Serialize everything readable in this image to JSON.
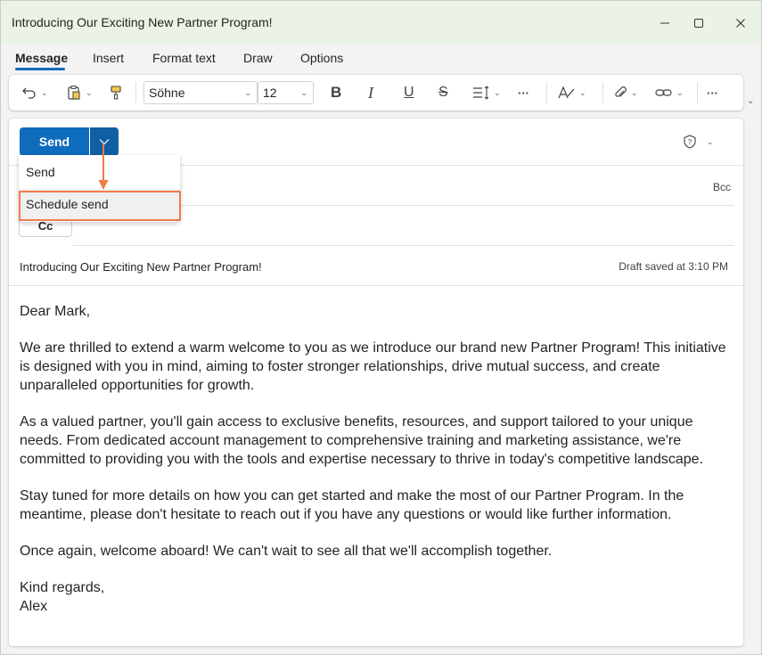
{
  "window": {
    "title": "Introducing Our Exciting New Partner Program!"
  },
  "tabs": [
    {
      "label": "Message",
      "active": true
    },
    {
      "label": "Insert"
    },
    {
      "label": "Format text"
    },
    {
      "label": "Draw"
    },
    {
      "label": "Options"
    }
  ],
  "ribbon": {
    "font_name": "Söhne",
    "font_size": "12",
    "bold_glyph": "B",
    "italic_glyph": "I",
    "underline_glyph": "U",
    "strike_glyph": "S",
    "more_glyph": "···"
  },
  "compose": {
    "send_label": "Send",
    "bcc_label": "Bcc",
    "cc_label": "Cc",
    "subject": "Introducing Our Exciting New Partner Program!",
    "draft_status": "Draft saved at 3:10 PM"
  },
  "send_menu": {
    "items": [
      {
        "label": "Send"
      },
      {
        "label": "Schedule send",
        "highlighted": true
      }
    ]
  },
  "body": {
    "greeting": "Dear Mark,",
    "p1": "We are thrilled to extend a warm welcome to you as we introduce our brand new Partner Program! This initiative is designed with you in mind, aiming to foster stronger relationships, drive mutual success, and create unparalleled opportunities for growth.",
    "p2": "As a valued partner, you'll gain access to exclusive benefits, resources, and support tailored to your unique needs. From dedicated account management to comprehensive training and marketing assistance, we're committed to providing you with the tools and expertise necessary to thrive in today's competitive landscape.",
    "p3": "Stay tuned for more details on how you can get started and make the most of our Partner Program. In the meantime, please don't hesitate to reach out if you have any questions or would like further information.",
    "p4": "Once again, welcome aboard! We can't wait to see all that we'll accomplish together.",
    "closing": "Kind regards,",
    "signature": "Alex"
  },
  "colors": {
    "accent": "#0f6cbd",
    "highlight_annotation": "#f07c48",
    "titlebar": "#eaf3e6"
  }
}
